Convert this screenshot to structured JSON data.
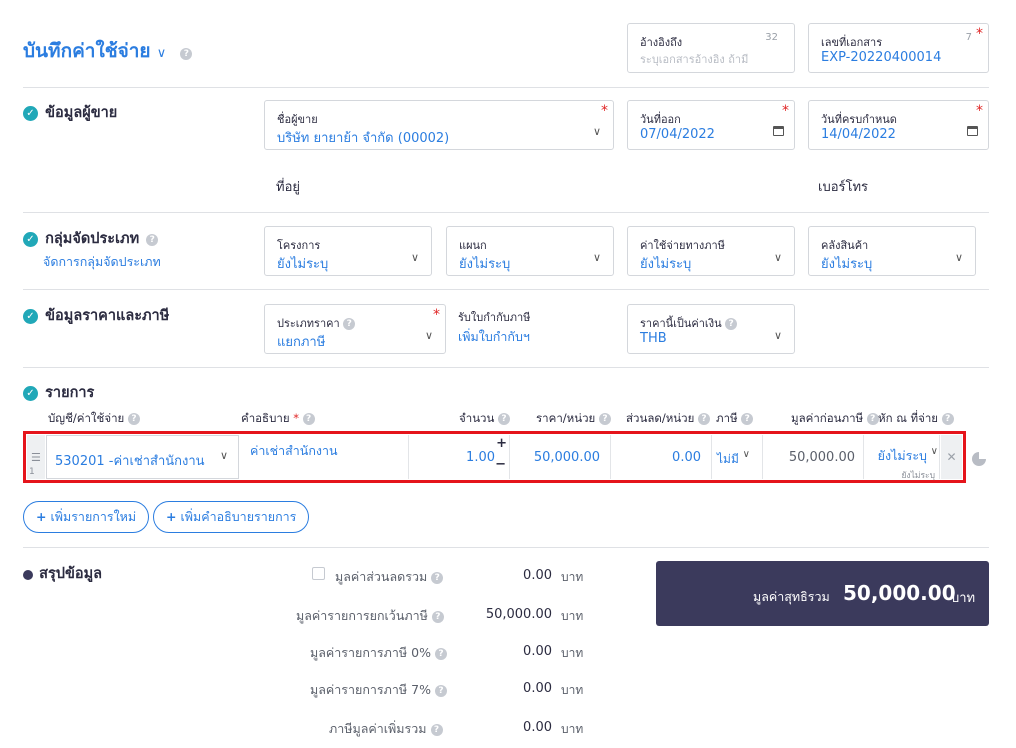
{
  "header": {
    "title": "บันทึกค่าใช้จ่าย"
  },
  "reference": {
    "label": "อ้างอิงถึง",
    "count": "32",
    "placeholder": "ระบุเอกสารอ้างอิง ถ้ามี"
  },
  "docnum": {
    "label": "เลขที่เอกสาร",
    "count": "7",
    "value": "EXP-20220400014"
  },
  "vendor_section": {
    "title": "ข้อมูลผู้ขาย",
    "vendor_label": "ชื่อผู้ขาย",
    "vendor_value": "บริษัท ยายาย้า จำกัด (00002)",
    "issue_label": "วันที่ออก",
    "issue_value": "07/04/2022",
    "due_label": "วันที่ครบกำหนด",
    "due_value": "14/04/2022",
    "address_label": "ที่อยู่",
    "phone_label": "เบอร์โทร"
  },
  "group_section": {
    "title": "กลุ่มจัดประเภท",
    "link": "จัดการกลุ่มจัดประเภท",
    "project_label": "โครงการ",
    "project_value": "ยังไม่ระบุ",
    "dept_label": "แผนก",
    "dept_value": "ยังไม่ระบุ",
    "taxexp_label": "ค่าใช้จ่ายทางภาษี",
    "taxexp_value": "ยังไม่ระบุ",
    "warehouse_label": "คลังสินค้า",
    "warehouse_value": "ยังไม่ระบุ"
  },
  "price_section": {
    "title": "ข้อมูลราคาและภาษี",
    "pricetype_label": "ประเภทราคา",
    "pricetype_value": "แยกภาษี",
    "invoice_label": "รับใบกำกับภาษี",
    "invoice_link": "เพิ่มใบกำกับฯ",
    "currency_label": "ราคานี้เป็นค่าเงิน",
    "currency_value": "THB"
  },
  "items_section": {
    "title": "รายการ",
    "columns": {
      "account": "บัญชี/ค่าใช้จ่าย",
      "desc": "คำอธิบาย",
      "qty": "จำนวน",
      "price": "ราคา/หน่วย",
      "discount": "ส่วนลด/หน่วย",
      "tax": "ภาษี",
      "pretax": "มูลค่าก่อนภาษี",
      "wht": "หัก ณ ที่จ่าย"
    },
    "rows": [
      {
        "num": "1",
        "account": "530201 -ค่าเช่าสำนักงาน",
        "desc": "ค่าเช่าสำนักงาน",
        "qty": "1.00",
        "price": "50,000.00",
        "discount": "0.00",
        "tax": "ไม่มี",
        "pretax": "50,000.00",
        "wht": "ยังไม่ระบุ",
        "wht_sub": "ยังไม่ระบุ"
      }
    ],
    "add_item": "เพิ่มรายการใหม่",
    "add_desc": "เพิ่มคำอธิบายรายการ"
  },
  "summary": {
    "title": "สรุปข้อมูล",
    "rows": [
      {
        "label": "มูลค่าส่วนลดรวม",
        "value": "0.00",
        "unit": "บาท"
      },
      {
        "label": "มูลค่ารายการยกเว้นภาษี",
        "value": "50,000.00",
        "unit": "บาท"
      },
      {
        "label": "มูลค่ารายการภาษี 0%",
        "value": "0.00",
        "unit": "บาท"
      },
      {
        "label": "มูลค่ารายการภาษี 7%",
        "value": "0.00",
        "unit": "บาท"
      },
      {
        "label": "ภาษีมูลค่าเพิ่มรวม",
        "value": "0.00",
        "unit": "บาท"
      }
    ],
    "total_label": "มูลค่าสุทธิรวม",
    "total_value": "50,000.00",
    "total_unit": "บาท"
  },
  "colors": {
    "accent": "#2b7de0",
    "check": "#21a8b8",
    "total_bg": "#3b3a5c",
    "highlight": "#e5141b"
  }
}
